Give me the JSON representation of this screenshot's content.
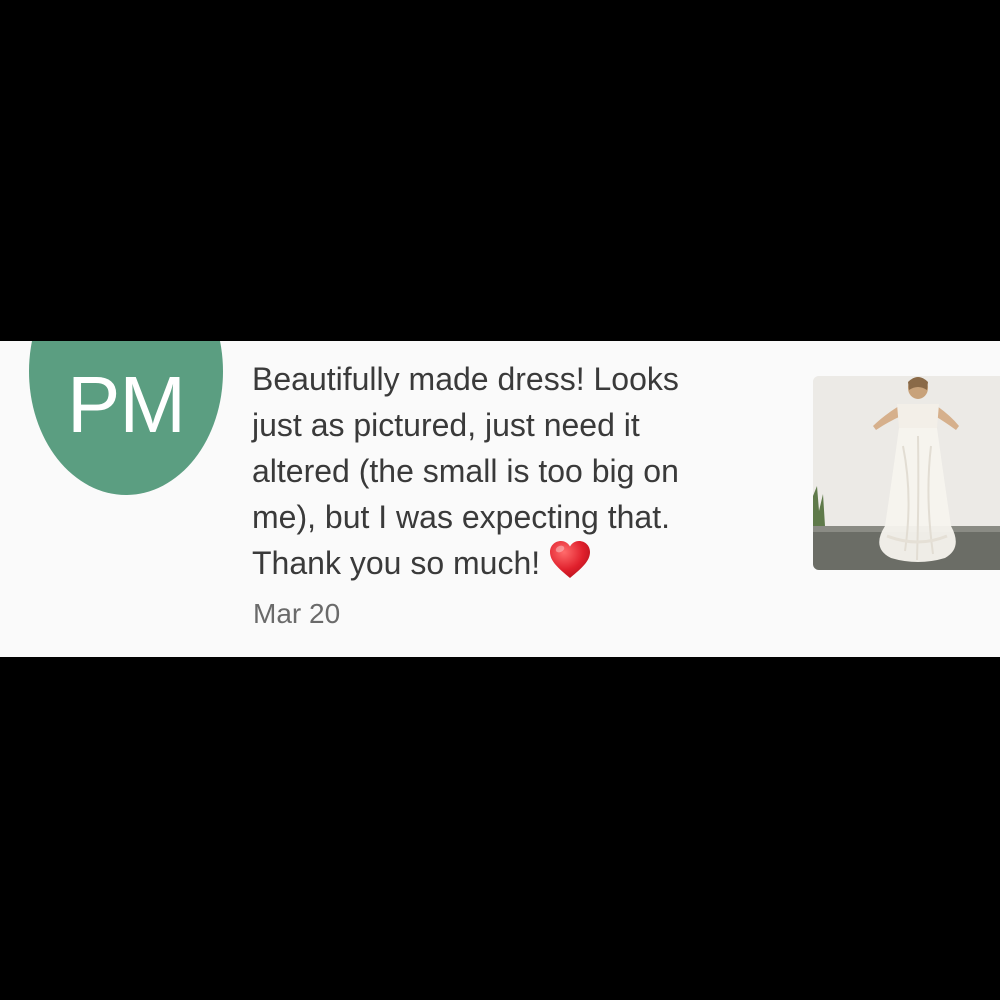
{
  "review": {
    "avatar": {
      "initials": "PM",
      "color": "#5b9e81"
    },
    "text_lines": [
      "Beautifully made dress! Looks",
      "just as pictured, just need it",
      "altered (the small is too big on",
      "me), but I was expecting that.",
      "Thank you so much!"
    ],
    "emoji": "heart-icon",
    "date": "Mar 20",
    "photo": {
      "icon": "dress-photo",
      "subject": "person in long white lace dress"
    }
  },
  "colors": {
    "background": "#000000",
    "card": "#fafafa",
    "text": "#3a3a3a",
    "date": "#6a6a6a",
    "heart": "#e0202c"
  }
}
